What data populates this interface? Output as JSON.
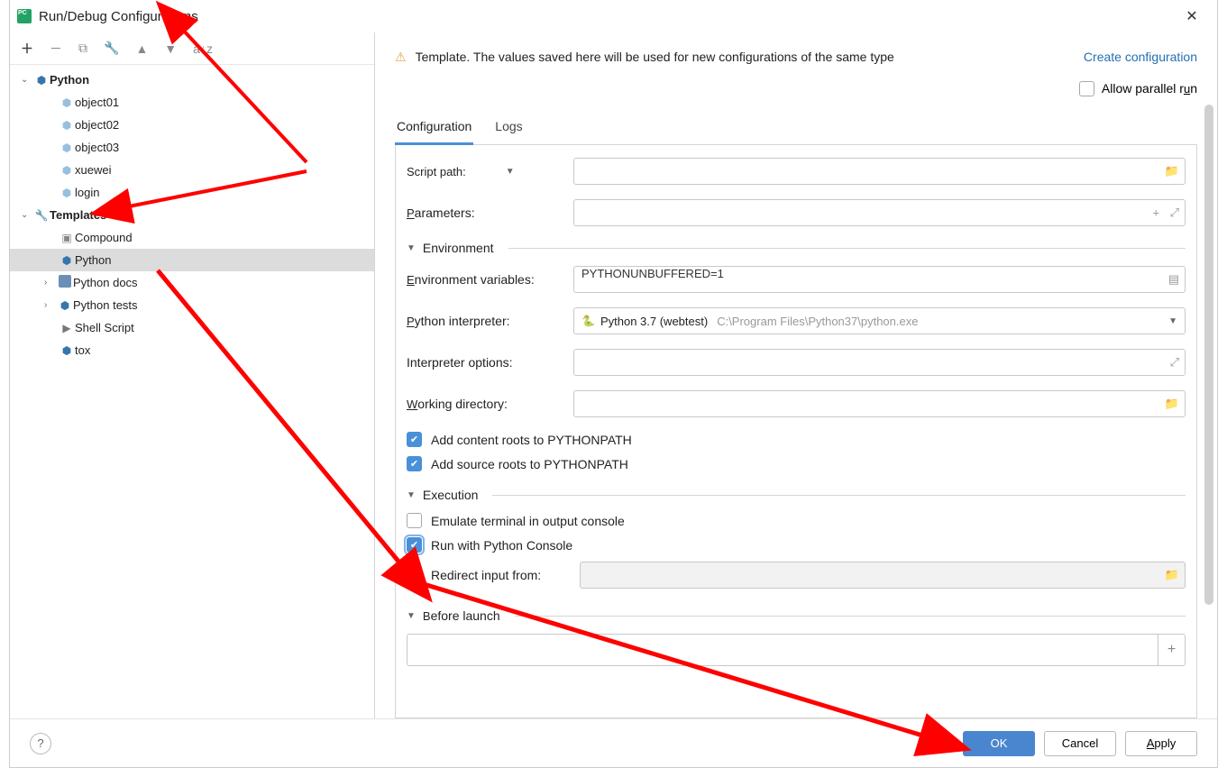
{
  "title": "Run/Debug Configurations",
  "tree": {
    "python": "Python",
    "items": [
      "object01",
      "object02",
      "object03",
      "xuewei",
      "login"
    ],
    "templates": "Templates",
    "tpl": [
      "Compound",
      "Python",
      "Python docs",
      "Python tests",
      "Shell Script",
      "tox"
    ]
  },
  "banner": {
    "msg": "Template. The values saved here will be used for new configurations of the same type",
    "link": "Create configuration"
  },
  "allowParallel": "Allow parallel run",
  "tabs": {
    "configuration": "Configuration",
    "logs": "Logs"
  },
  "labels": {
    "scriptPath": "Script path:",
    "parameters": "Parameters:",
    "environment": "Environment",
    "envVars": "Environment variables:",
    "pyInterp": "Python interpreter:",
    "interpOpts": "Interpreter options:",
    "workDir": "Working directory:",
    "addContent": "Add content roots to PYTHONPATH",
    "addSource": "Add source roots to PYTHONPATH",
    "execution": "Execution",
    "emulate": "Emulate terminal in output console",
    "runConsole": "Run with Python Console",
    "redirect": "Redirect input from:",
    "before": "Before launch"
  },
  "values": {
    "envVars": "PYTHONUNBUFFERED=1",
    "interpreter": {
      "name": "Python 3.7 (webtest)",
      "path": "C:\\Program Files\\Python37\\python.exe"
    }
  },
  "buttons": {
    "ok": "OK",
    "cancel": "Cancel",
    "apply": "Apply"
  }
}
